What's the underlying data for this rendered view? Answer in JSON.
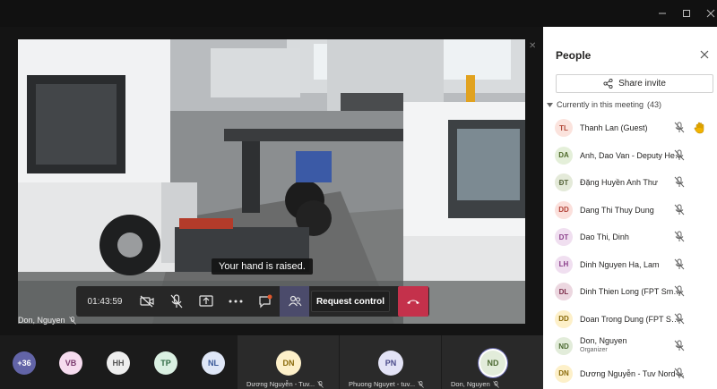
{
  "presenter": {
    "name": "Don, Nguyen"
  },
  "meeting": {
    "timer": "01:43:59",
    "hand_toast": "Your hand is raised.",
    "request_control_label": "Request control"
  },
  "panel": {
    "title": "People",
    "share_invite": "Share invite",
    "section_label": "Currently in this meeting",
    "section_count": "(43)",
    "participants": [
      {
        "initials": "TL",
        "name": "Thanh Lan (Guest)",
        "role": "",
        "avatar_bg": "#fbe3dd",
        "avatar_fg": "#b24a3a",
        "hand": true
      },
      {
        "initials": "DA",
        "name": "Anh, Dao Van - Deputy Head...",
        "role": "",
        "avatar_bg": "#e4efd9",
        "avatar_fg": "#4f6b2b",
        "hand": false
      },
      {
        "initials": "ĐT",
        "name": "Đặng Huyền Anh Thư",
        "role": "",
        "avatar_bg": "#e4ead9",
        "avatar_fg": "#55633a",
        "hand": false
      },
      {
        "initials": "DD",
        "name": "Dang Thi Thuy Dung",
        "role": "",
        "avatar_bg": "#fbe0dc",
        "avatar_fg": "#b3443a",
        "hand": false
      },
      {
        "initials": "DT",
        "name": "Dao Thi, Dinh",
        "role": "",
        "avatar_bg": "#f0dff0",
        "avatar_fg": "#8a3f8a",
        "hand": false
      },
      {
        "initials": "LH",
        "name": "Dinh Nguyen Ha, Lam",
        "role": "",
        "avatar_bg": "#f0dff0",
        "avatar_fg": "#8a3f8a",
        "hand": false
      },
      {
        "initials": "DL",
        "name": "Dinh Thien Long (FPT Smart ...",
        "role": "",
        "avatar_bg": "#ecd7e0",
        "avatar_fg": "#7d2f4c",
        "hand": false
      },
      {
        "initials": "DD",
        "name": "Doan Trong Dung (FPT Smar...",
        "role": "",
        "avatar_bg": "#fdf0c9",
        "avatar_fg": "#8a6a0a",
        "hand": false
      },
      {
        "initials": "ND",
        "name": "Don, Nguyen",
        "role": "Organizer",
        "avatar_bg": "#e2ecda",
        "avatar_fg": "#4c6a32",
        "hand": false
      },
      {
        "initials": "DN",
        "name": "Dương Nguyễn - Tuv Nord ...",
        "role": "",
        "avatar_bg": "#fdf0c9",
        "avatar_fg": "#8a6a0a",
        "hand": false
      }
    ]
  },
  "gallery": {
    "overflow": "+36",
    "avatars": [
      {
        "initials": "VB",
        "bg": "#f6dcef",
        "fg": "#7a3a6e"
      },
      {
        "initials": "HH",
        "bg": "#eeeeee",
        "fg": "#555555"
      },
      {
        "initials": "TP",
        "bg": "#daf0e2",
        "fg": "#2f6a44"
      },
      {
        "initials": "NL",
        "bg": "#dfe7f7",
        "fg": "#3b5998"
      }
    ],
    "tiles": [
      {
        "initials": "DN",
        "name": "Dương Nguyễn - Tuv...",
        "bg": "#fdf0c9",
        "fg": "#8a6a0a",
        "selected": false
      },
      {
        "initials": "PN",
        "name": "Phuong Nguyet - tuv...",
        "bg": "#e3e3f6",
        "fg": "#4b4b8a",
        "selected": false
      },
      {
        "initials": "ND",
        "name": "Don, Nguyen",
        "bg": "#e2ecda",
        "fg": "#4c6a32",
        "selected": true
      }
    ]
  },
  "colors": {
    "hangup": "#c4314b",
    "accent": "#6264a7",
    "raised_hand": "#f2b300"
  }
}
